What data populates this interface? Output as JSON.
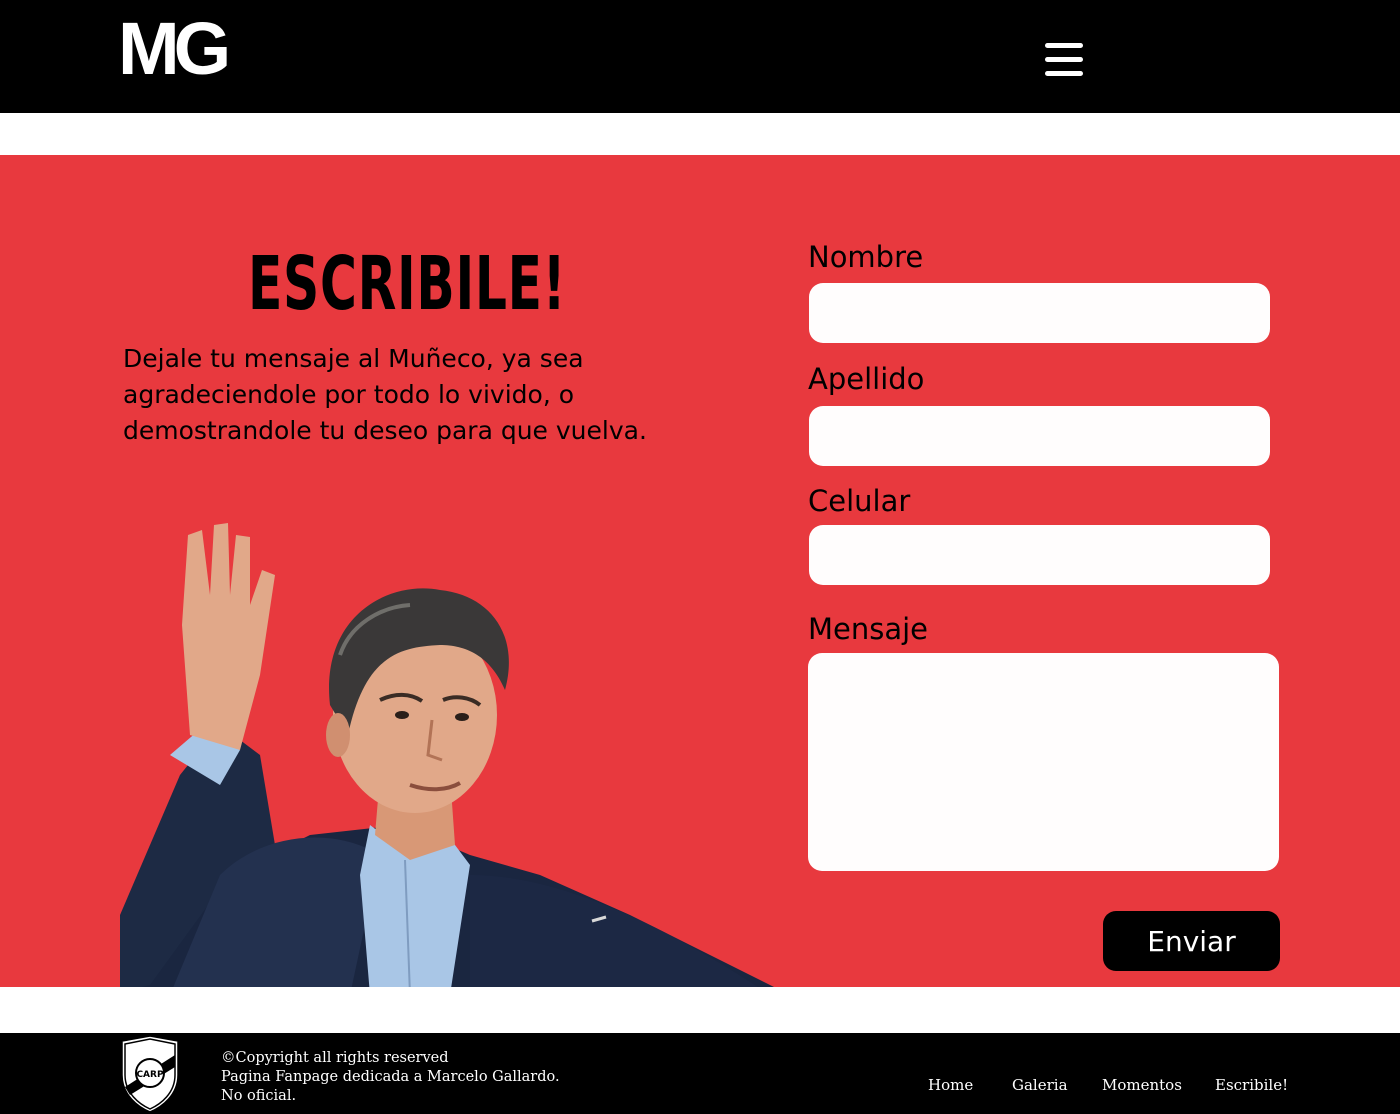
{
  "header": {
    "logo_text": "MG",
    "menu_icon": "hamburger-menu-icon"
  },
  "contact": {
    "title": "ESCRIBILE!",
    "intro": "Dejale tu mensaje al Muñeco, ya sea agradeciendole por todo lo vivido, o demostrandole tu deseo para que vuelva.",
    "form": {
      "nombre_label": "Nombre",
      "apellido_label": "Apellido",
      "celular_label": "Celular",
      "mensaje_label": "Mensaje",
      "submit_label": "Enviar"
    },
    "colors": {
      "background": "#e8393e",
      "input": "#fffdfd",
      "button": "#000000"
    }
  },
  "footer": {
    "crest_icon": "river-plate-crest-icon",
    "crest_text": "CARP",
    "copyright_line1": "©Copyright all rights reserved",
    "copyright_line2": "Pagina Fanpage dedicada a Marcelo Gallardo.",
    "copyright_line3": "No oficial.",
    "nav": [
      "Home",
      "Galeria",
      "Momentos",
      "Escribile!"
    ]
  }
}
